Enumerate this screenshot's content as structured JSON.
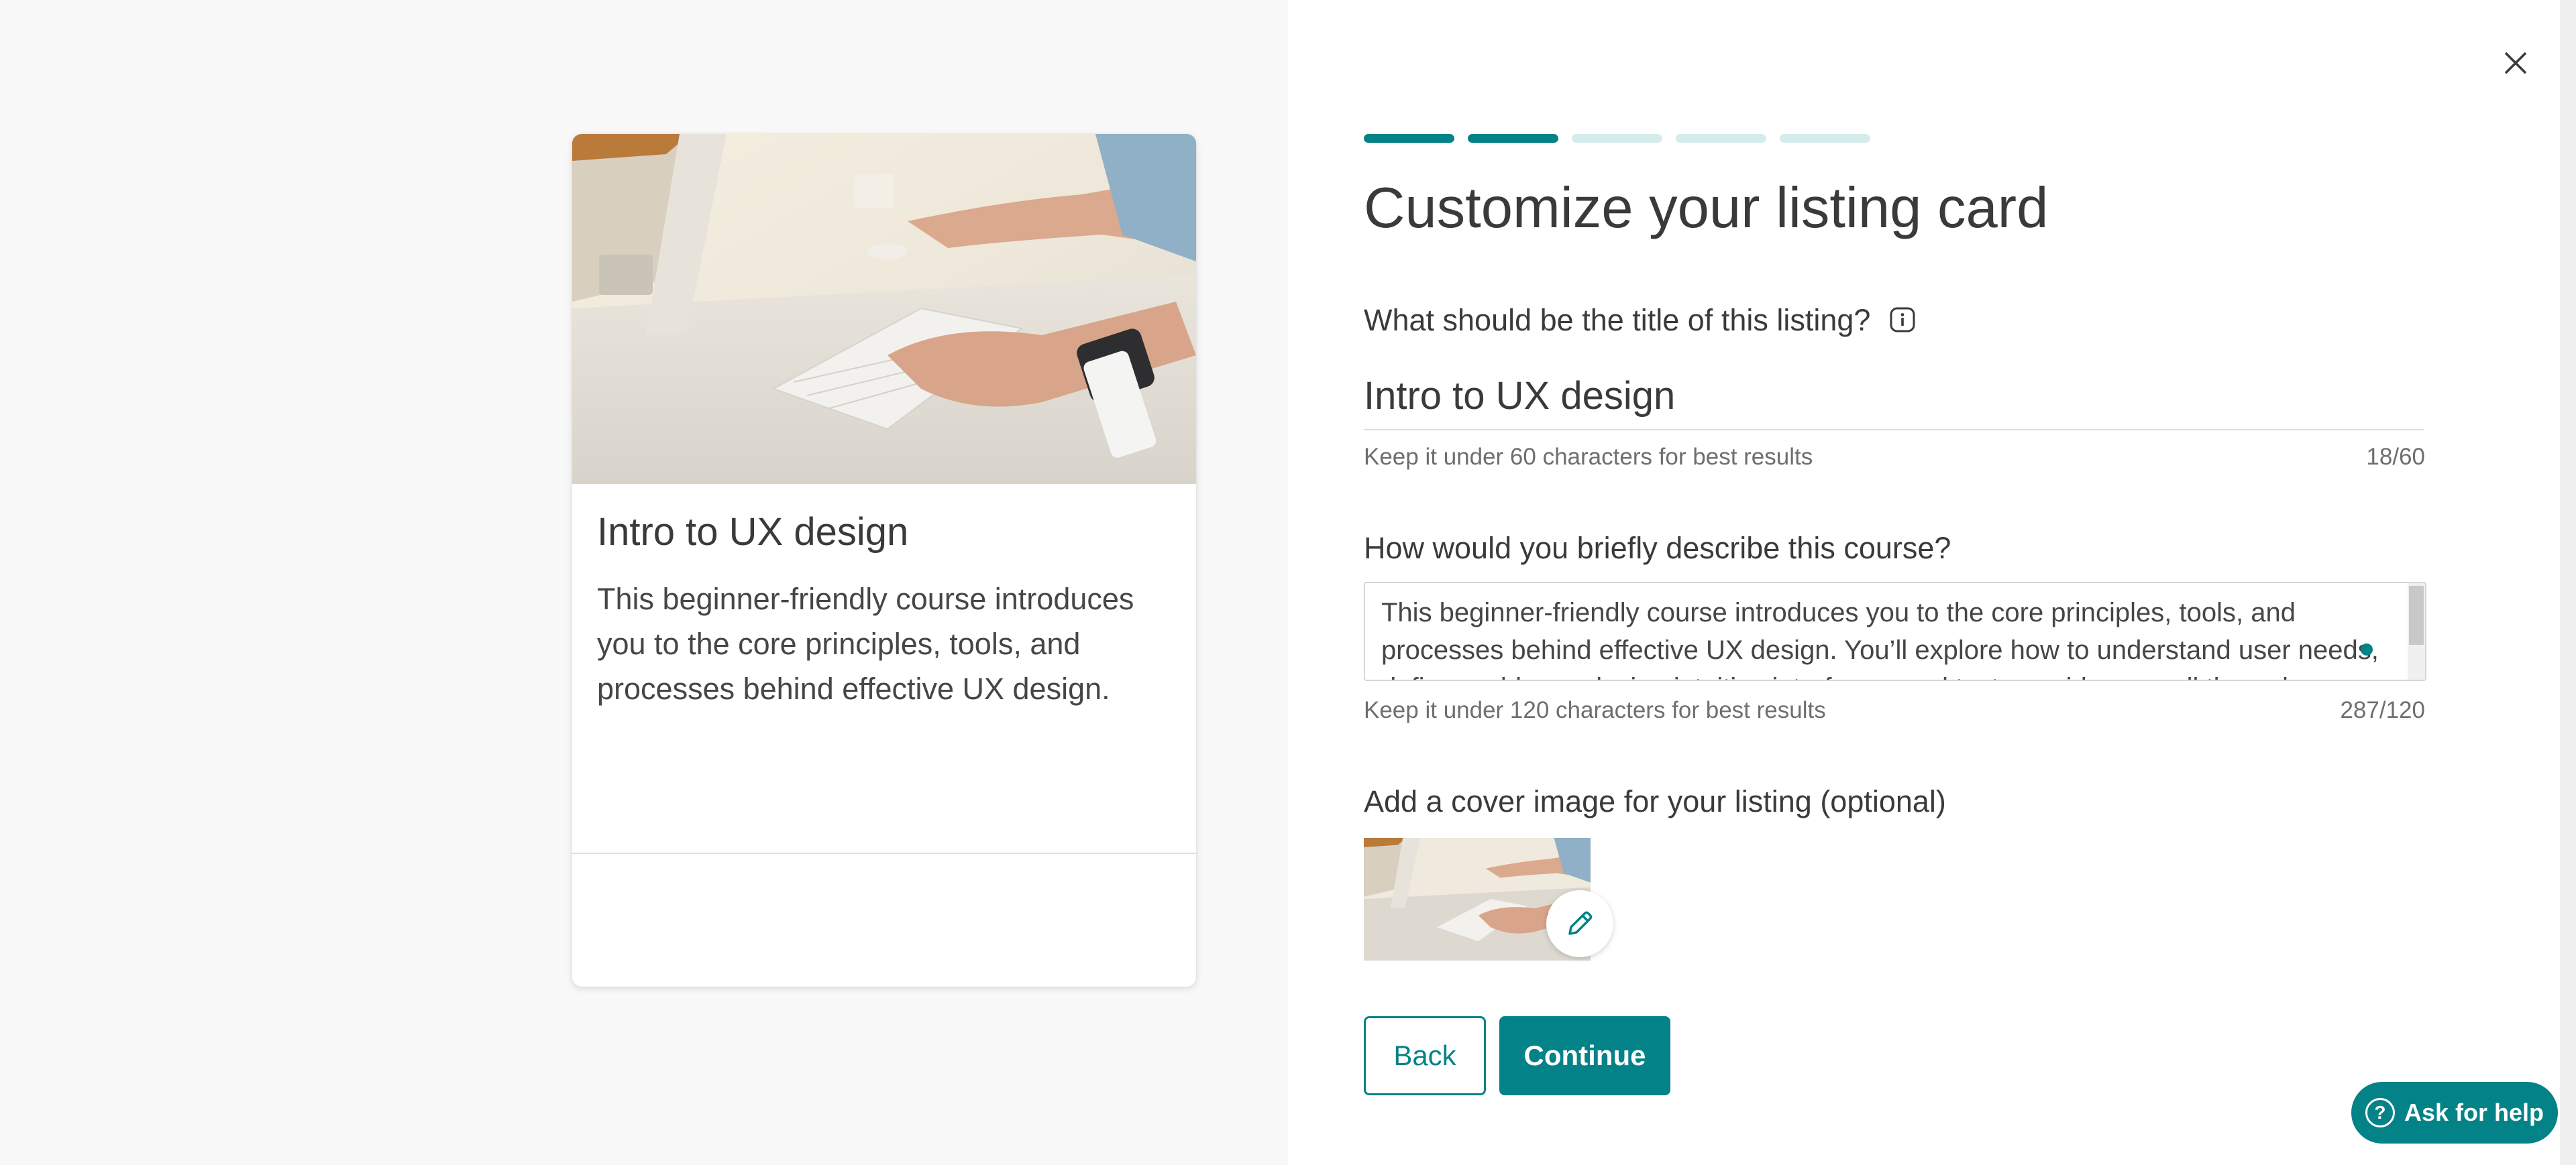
{
  "preview": {
    "title": "Intro to UX design",
    "description": "This beginner-friendly course introduces you to the core principles, tools, and processes behind effective UX design."
  },
  "dialog": {
    "heading": "Customize your listing card",
    "progress": {
      "total_steps": 5,
      "completed_steps": 2
    },
    "title_field": {
      "label": "What should be the title of this listing?",
      "value": "Intro to UX design",
      "hint": "Keep it under 60 characters for best results",
      "count": "18/60"
    },
    "description_field": {
      "label": "How would you briefly describe this course?",
      "value": "This beginner-friendly course introduces you to the core principles, tools, and processes behind effective UX design. You’ll explore how to understand user needs, define problems, design intuitive interfaces, and test your ideas — all through",
      "hint": "Keep it under 120 characters for best results",
      "count": "287/120"
    },
    "cover_field": {
      "label": "Add a cover image for your listing (optional)"
    },
    "buttons": {
      "back": "Back",
      "continue": "Continue"
    }
  },
  "help": {
    "label": "Ask for help"
  },
  "icons": {
    "close": "close-icon",
    "info": "info-icon",
    "edit": "pencil-icon",
    "help": "question-icon"
  },
  "colors": {
    "accent": "#038387",
    "accent_light": "#d6ecec",
    "left_background": "#f8f8f8"
  }
}
